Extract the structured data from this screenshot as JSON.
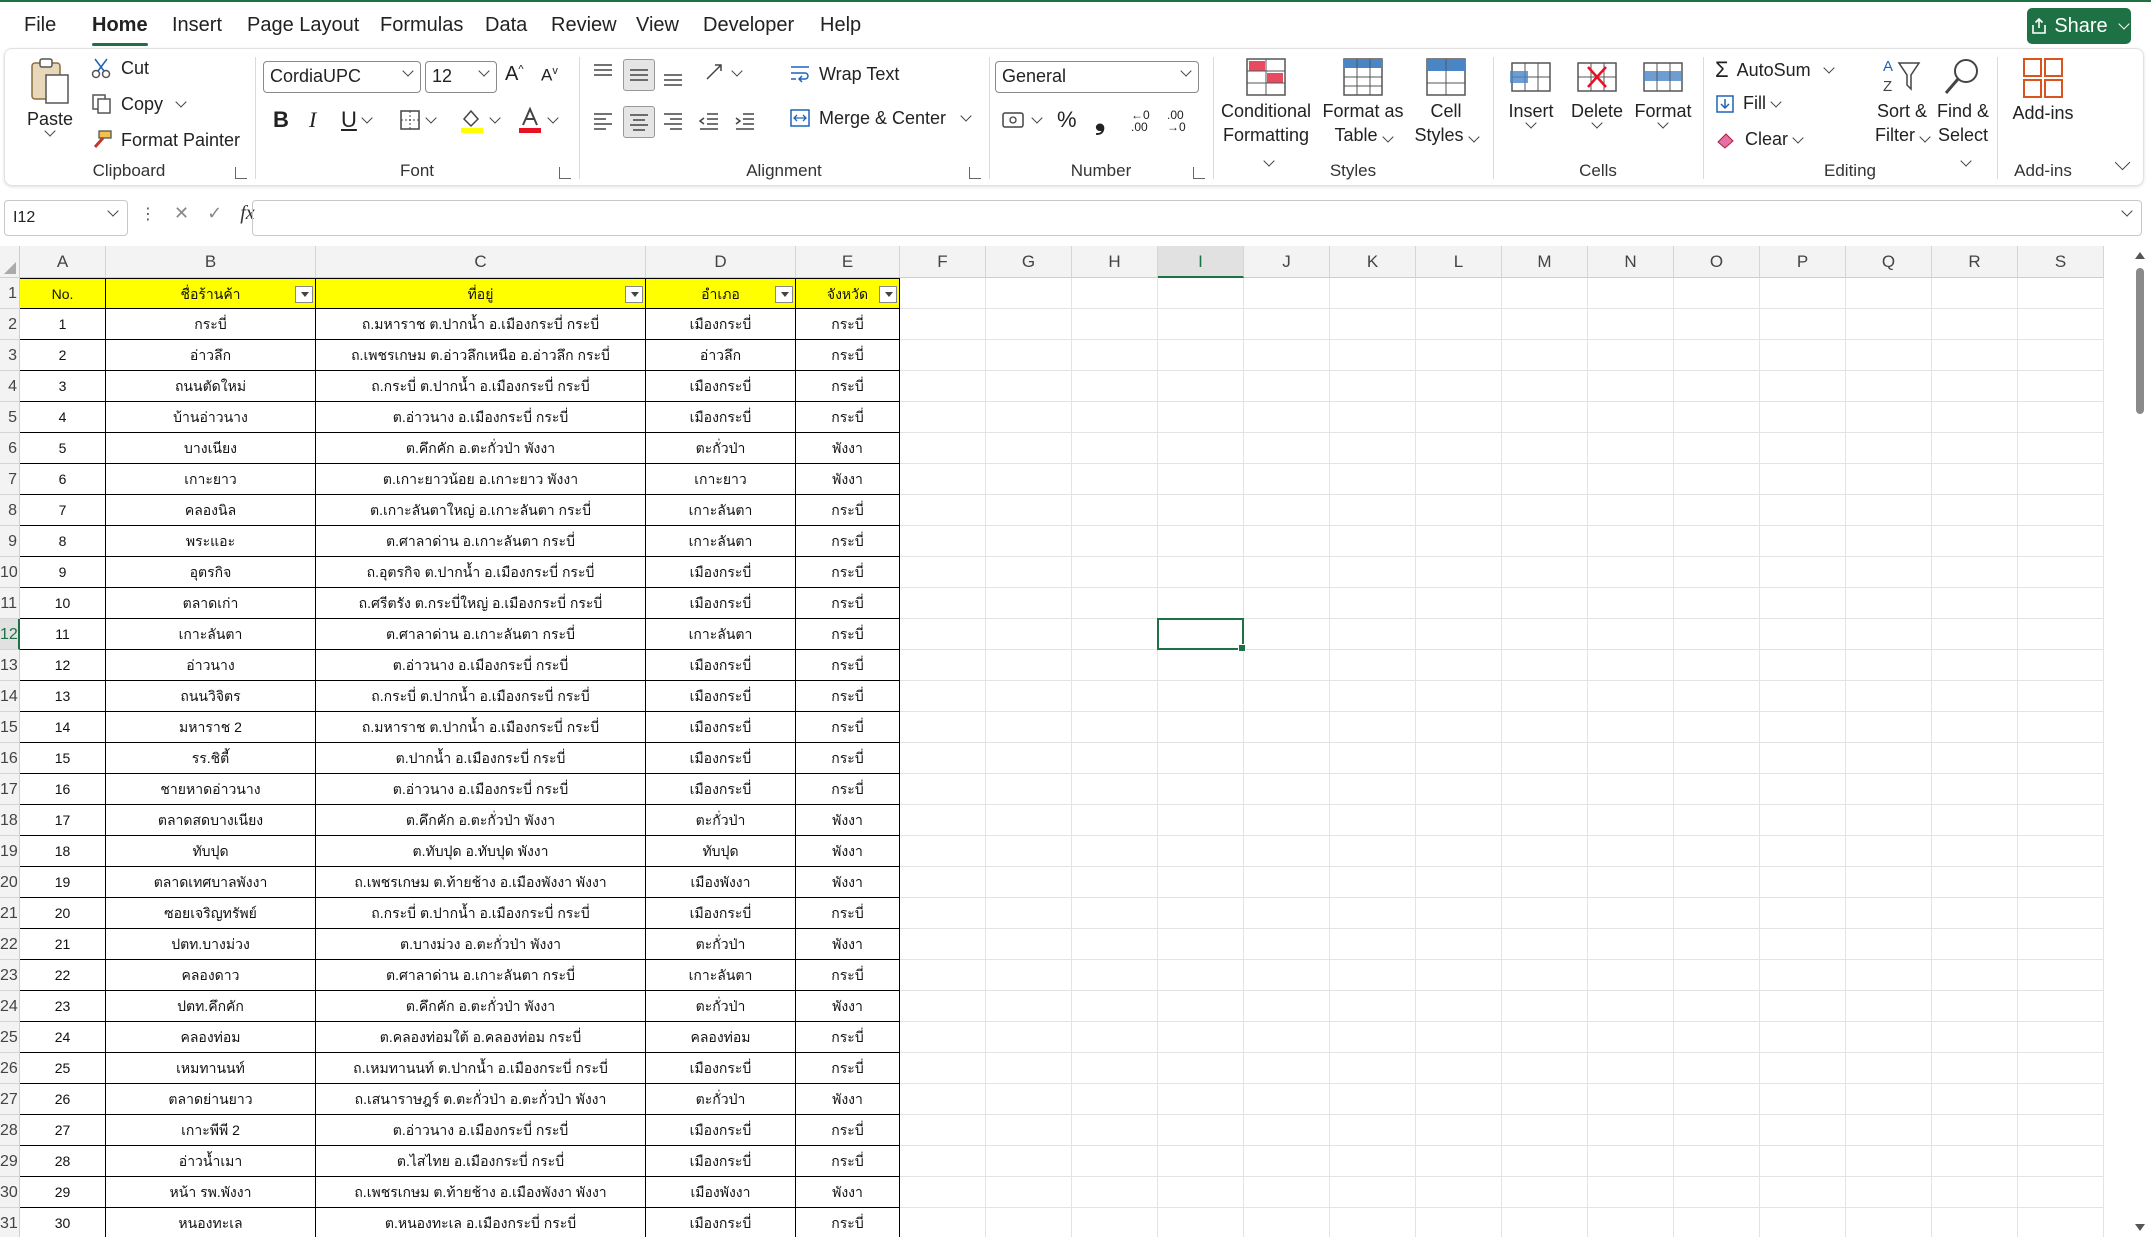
{
  "menu": {
    "items": [
      "File",
      "Home",
      "Insert",
      "Page Layout",
      "Formulas",
      "Data",
      "Review",
      "View",
      "Developer",
      "Help"
    ],
    "active": "Home",
    "share_label": "Share"
  },
  "ribbon": {
    "clipboard": {
      "label": "Clipboard",
      "paste": "Paste",
      "cut": "Cut",
      "copy": "Copy",
      "format_painter": "Format Painter"
    },
    "font": {
      "label": "Font",
      "font_name": "CordiaUPC",
      "font_size": "12",
      "bold": "B",
      "italic": "I",
      "underline": "U"
    },
    "alignment": {
      "label": "Alignment",
      "wrap_text": "Wrap Text",
      "merge_center": "Merge & Center"
    },
    "number": {
      "label": "Number",
      "format": "General"
    },
    "styles": {
      "label": "Styles",
      "conditional_line1": "Conditional",
      "conditional_line2": "Formatting",
      "format_table_line1": "Format as",
      "format_table_line2": "Table",
      "cell_styles_line1": "Cell",
      "cell_styles_line2": "Styles"
    },
    "cells": {
      "label": "Cells",
      "insert": "Insert",
      "delete": "Delete",
      "format": "Format"
    },
    "editing": {
      "label": "Editing",
      "autosum": "AutoSum",
      "fill": "Fill",
      "clear": "Clear",
      "sort_line1": "Sort &",
      "sort_line2": "Filter",
      "find_line1": "Find &",
      "find_line2": "Select"
    },
    "addins": {
      "label": "Add-ins",
      "addins": "Add-ins"
    }
  },
  "formula_bar": {
    "name_box": "I12",
    "fx": "fx",
    "value": ""
  },
  "columns": [
    "A",
    "B",
    "C",
    "D",
    "E",
    "F",
    "G",
    "H",
    "I",
    "J",
    "K",
    "L",
    "M",
    "N",
    "O",
    "P",
    "Q",
    "R",
    "S"
  ],
  "selected_cell": {
    "col": "I",
    "row": 12
  },
  "header_row": [
    "No.",
    "ชื่อร้านค้า",
    "ที่อยู่",
    "อำเภอ",
    "จังหวัด"
  ],
  "rows": [
    [
      "1",
      "กระบี่",
      "ถ.มหาราช ต.ปากน้ำ อ.เมืองกระบี่ กระบี่",
      "เมืองกระบี่",
      "กระบี่"
    ],
    [
      "2",
      "อ่าวลึก",
      "ถ.เพชรเกษม ต.อ่าวลึกเหนือ อ.อ่าวลึก กระบี่",
      "อ่าวลึก",
      "กระบี่"
    ],
    [
      "3",
      "ถนนตัดใหม่",
      "ถ.กระบี่ ต.ปากน้ำ อ.เมืองกระบี่ กระบี่",
      "เมืองกระบี่",
      "กระบี่"
    ],
    [
      "4",
      "บ้านอ่าวนาง",
      "ต.อ่าวนาง อ.เมืองกระบี่ กระบี่",
      "เมืองกระบี่",
      "กระบี่"
    ],
    [
      "5",
      "บางเนียง",
      "ต.คึกคัก อ.ตะกั่วป่า พังงา",
      "ตะกั่วป่า",
      "พังงา"
    ],
    [
      "6",
      "เกาะยาว",
      "ต.เกาะยาวน้อย อ.เกาะยาว พังงา",
      "เกาะยาว",
      "พังงา"
    ],
    [
      "7",
      "คลองนิล",
      "ต.เกาะลันตาใหญ่ อ.เกาะลันตา กระบี่",
      "เกาะลันตา",
      "กระบี่"
    ],
    [
      "8",
      "พระแอะ",
      "ต.ศาลาด่าน อ.เกาะลันตา กระบี่",
      "เกาะลันตา",
      "กระบี่"
    ],
    [
      "9",
      "อุตรกิจ",
      "ถ.อุตรกิจ ต.ปากน้ำ อ.เมืองกระบี่ กระบี่",
      "เมืองกระบี่",
      "กระบี่"
    ],
    [
      "10",
      "ตลาดเก่า",
      "ถ.ศรีตรัง ต.กระบี่ใหญ่ อ.เมืองกระบี่ กระบี่",
      "เมืองกระบี่",
      "กระบี่"
    ],
    [
      "11",
      "เกาะลันตา",
      "ต.ศาลาด่าน อ.เกาะลันตา กระบี่",
      "เกาะลันตา",
      "กระบี่"
    ],
    [
      "12",
      "อ่าวนาง",
      "ต.อ่าวนาง อ.เมืองกระบี่ กระบี่",
      "เมืองกระบี่",
      "กระบี่"
    ],
    [
      "13",
      "ถนนวิจิตร",
      "ถ.กระบี่ ต.ปากน้ำ อ.เมืองกระบี่ กระบี่",
      "เมืองกระบี่",
      "กระบี่"
    ],
    [
      "14",
      "มหาราช 2",
      "ถ.มหาราช ต.ปากน้ำ อ.เมืองกระบี่ กระบี่",
      "เมืองกระบี่",
      "กระบี่"
    ],
    [
      "15",
      "รร.ชิตี้",
      "ต.ปากน้ำ อ.เมืองกระบี่ กระบี่",
      "เมืองกระบี่",
      "กระบี่"
    ],
    [
      "16",
      "ชายหาดอ่าวนาง",
      "ต.อ่าวนาง อ.เมืองกระบี่ กระบี่",
      "เมืองกระบี่",
      "กระบี่"
    ],
    [
      "17",
      "ตลาดสดบางเนียง",
      "ต.คึกคัก อ.ตะกั่วป่า พังงา",
      "ตะกั่วป่า",
      "พังงา"
    ],
    [
      "18",
      "ทับปุด",
      "ต.ทับปุด อ.ทับปุด พังงา",
      "ทับปุด",
      "พังงา"
    ],
    [
      "19",
      "ตลาดเทศบาลพังงา",
      "ถ.เพชรเกษม ต.ท้ายช้าง อ.เมืองพังงา พังงา",
      "เมืองพังงา",
      "พังงา"
    ],
    [
      "20",
      "ซอยเจริญทรัพย์",
      "ถ.กระบี่ ต.ปากน้ำ อ.เมืองกระบี่ กระบี่",
      "เมืองกระบี่",
      "กระบี่"
    ],
    [
      "21",
      "ปตท.บางม่วง",
      "ต.บางม่วง อ.ตะกั่วป่า พังงา",
      "ตะกั่วป่า",
      "พังงา"
    ],
    [
      "22",
      "คลองดาว",
      "ต.ศาลาด่าน อ.เกาะลันตา กระบี่",
      "เกาะลันตา",
      "กระบี่"
    ],
    [
      "23",
      "ปตท.คึกคัก",
      "ต.คึกคัก อ.ตะกั่วป่า พังงา",
      "ตะกั่วป่า",
      "พังงา"
    ],
    [
      "24",
      "คลองท่อม",
      "ต.คลองท่อมใต้ อ.คลองท่อม กระบี่",
      "คลองท่อม",
      "กระบี่"
    ],
    [
      "25",
      "เหมทานนท์",
      "ถ.เหมทานนท์ ต.ปากน้ำ อ.เมืองกระบี่ กระบี่",
      "เมืองกระบี่",
      "กระบี่"
    ],
    [
      "26",
      "ตลาดย่านยาว",
      "ถ.เสนาราษฎร์ ต.ตะกั่วป่า อ.ตะกั่วป่า พังงา",
      "ตะกั่วป่า",
      "พังงา"
    ],
    [
      "27",
      "เกาะพีพี 2",
      "ต.อ่าวนาง อ.เมืองกระบี่ กระบี่",
      "เมืองกระบี่",
      "กระบี่"
    ],
    [
      "28",
      "อ่าวน้ำเมา",
      "ต.ไสไทย อ.เมืองกระบี่ กระบี่",
      "เมืองกระบี่",
      "กระบี่"
    ],
    [
      "29",
      "หน้า รพ.พังงา",
      "ถ.เพชรเกษม ต.ท้ายช้าง อ.เมืองพังงา พังงา",
      "เมืองพังงา",
      "พังงา"
    ],
    [
      "30",
      "หนองทะเล",
      "ต.หนองทะเล อ.เมืองกระบี่ กระบี่",
      "เมืองกระบี่",
      "กระบี่"
    ]
  ]
}
